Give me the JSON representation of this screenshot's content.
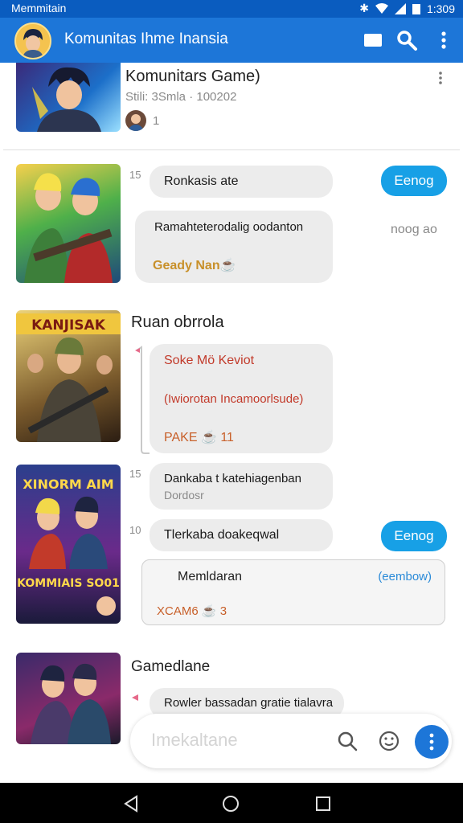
{
  "status_bar": {
    "carrier": "Memmitain",
    "time": "1:309"
  },
  "app_bar": {
    "title": "Komunitas Ihme Inansia"
  },
  "group_card": {
    "title": "Komunitars Game)",
    "subtitle": "Stili: 3Smla · 100202",
    "member_count": "1"
  },
  "posts": [
    {
      "time": "15",
      "bubble1": "Ronkasis ate",
      "send_label": "Eenog",
      "bubble2_text": "Ramahteterodalig oodanton",
      "bubble2_tag": "Geady Nan☕",
      "side_text": "noog ao"
    },
    {
      "title": "Ruan obrrola",
      "poster_text": "KANJISAK",
      "card_title": "Soke Mö Keviot",
      "card_body": "(Iwiorotan Incamoorlsude)",
      "card_footer": "PAKE ☕ 11"
    },
    {
      "time1": "15",
      "bubble1_line1": "Dankaba t katehiagenban",
      "bubble1_line2": "Dordosr",
      "time2": "10",
      "bubble2": "Tlerkaba doakeqwal",
      "send_label": "Eenog",
      "poster_top": "XINORM AIM",
      "poster_bottom": "KOMMIAIS SO01",
      "card_title": "Memldaran",
      "card_side": "(eembow)",
      "card_footer": "XCAM6 ☕ 3"
    },
    {
      "title": "Gamedlane",
      "bubble": "Rowler bassadan gratie tialavra"
    }
  ],
  "composer": {
    "placeholder": "Imekaltane"
  },
  "colors": {
    "primary": "#1d76d8",
    "status": "#0a5cbf",
    "send": "#17a0e6",
    "bubble": "#ececec"
  }
}
